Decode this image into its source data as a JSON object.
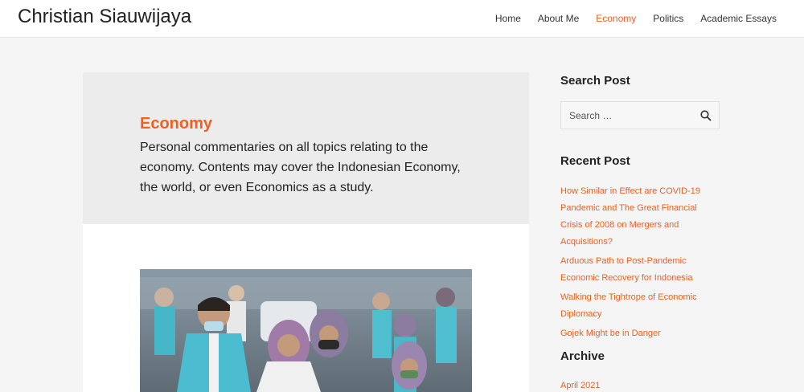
{
  "header": {
    "site_title": "Christian Siauwijaya",
    "nav": [
      {
        "label": "Home",
        "active": false
      },
      {
        "label": "About Me",
        "active": false
      },
      {
        "label": "Economy",
        "active": true
      },
      {
        "label": "Politics",
        "active": false
      },
      {
        "label": "Academic Essays",
        "active": false
      }
    ]
  },
  "archive": {
    "title": "Economy",
    "description": "Personal commentaries on all topics relating to the economy. Contents may cover the Indonesian Economy, the world, or even Economics as a study."
  },
  "sidebar": {
    "search": {
      "title": "Search Post",
      "placeholder": "Search …",
      "button_icon": "search-icon"
    },
    "recent": {
      "title": "Recent Post",
      "posts": [
        "How Similar in Effect are COVID-19 Pandemic and The Great Financial Crisis of 2008 on Mergers and Acquisitions?",
        "Arduous Path to Post-Pandemic Economic Recovery for Indonesia",
        "Walking the Tightrope of Economic Diplomacy",
        "Gojek Might be in Danger"
      ]
    },
    "archive": {
      "title": "Archive",
      "items": [
        "April 2021"
      ]
    }
  },
  "colors": {
    "accent": "#f06020",
    "background": "#f5f5f5",
    "header_bg": "#ffffff",
    "archive_header_bg": "#ececec"
  }
}
